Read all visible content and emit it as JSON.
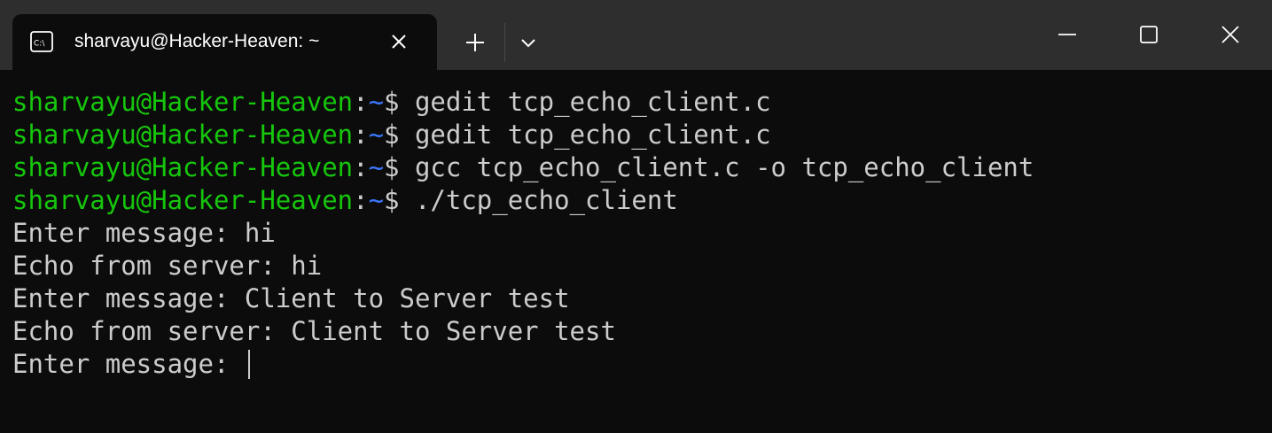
{
  "window": {
    "tab_title": "sharvayu@Hacker-Heaven: ~"
  },
  "icons": {
    "tab": "terminal-icon",
    "tab_close": "close-icon",
    "new_tab": "plus-icon",
    "dropdown": "chevron-down-icon",
    "minimize": "minimize-icon",
    "maximize": "maximize-icon",
    "close": "close-icon"
  },
  "colors": {
    "titlebar": "#2e2e2e",
    "background": "#0c0c0c",
    "prompt_user": "#16c60c",
    "prompt_path": "#3b78ff",
    "text": "#cccccc"
  },
  "terminal": {
    "prompt_user": "sharvayu@Hacker-Heaven",
    "prompt_sep": ":",
    "prompt_path": "~",
    "prompt_symbol": "$ ",
    "commands": [
      "gedit tcp_echo_client.c",
      "gedit tcp_echo_client.c",
      "gcc tcp_echo_client.c -o tcp_echo_client",
      "./tcp_echo_client"
    ],
    "output": [
      "Enter message: hi",
      "Echo from server: hi",
      "Enter message: Client to Server test",
      "Echo from server: Client to Server test",
      "Enter message: "
    ]
  }
}
